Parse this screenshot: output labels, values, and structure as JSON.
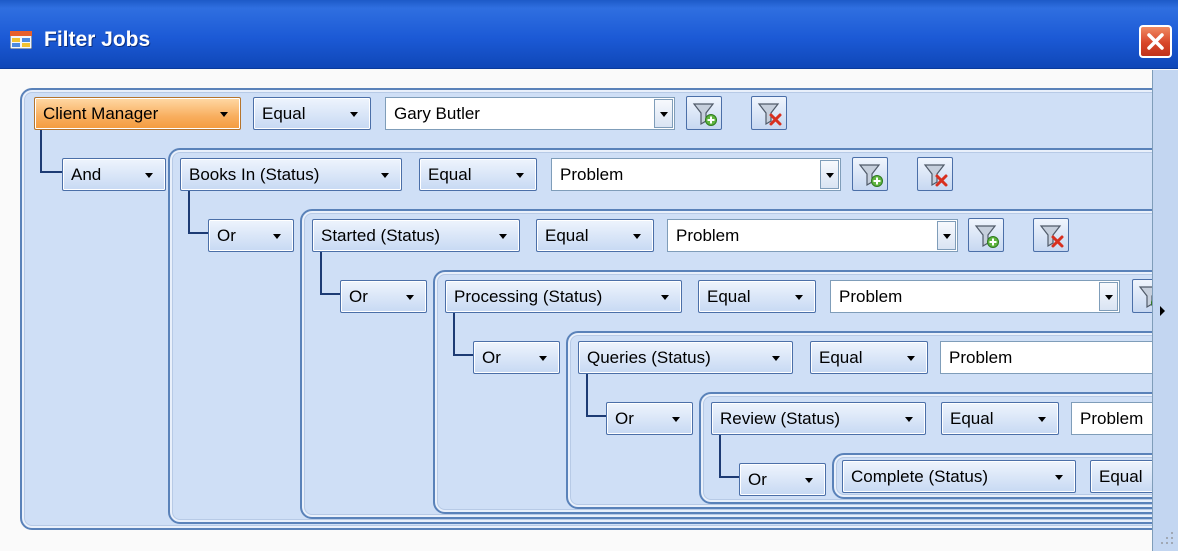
{
  "window": {
    "title": "Filter Jobs"
  },
  "filters": [
    {
      "field": "Client Manager",
      "operator": "Equal",
      "value": "Gary Butler"
    },
    {
      "logic": "And",
      "field": "Books In (Status)",
      "operator": "Equal",
      "value": "Problem"
    },
    {
      "logic": "Or",
      "field": "Started (Status)",
      "operator": "Equal",
      "value": "Problem"
    },
    {
      "logic": "Or",
      "field": "Processing (Status)",
      "operator": "Equal",
      "value": "Problem"
    },
    {
      "logic": "Or",
      "field": "Queries (Status)",
      "operator": "Equal",
      "value": "Problem"
    },
    {
      "logic": "Or",
      "field": "Review (Status)",
      "operator": "Equal",
      "value": "Problem"
    },
    {
      "logic": "Or",
      "field": "Complete (Status)",
      "operator": "Equal"
    }
  ],
  "icons": {
    "add_filter": "filter-add-icon",
    "remove_filter": "filter-remove-icon",
    "window": "window-form-icon",
    "close": "close-icon"
  },
  "colors": {
    "titlebar": "#1c5ad6",
    "panel": "#cfdff6",
    "selected_field": "#f8ae5e",
    "close_button": "#d8462a"
  }
}
